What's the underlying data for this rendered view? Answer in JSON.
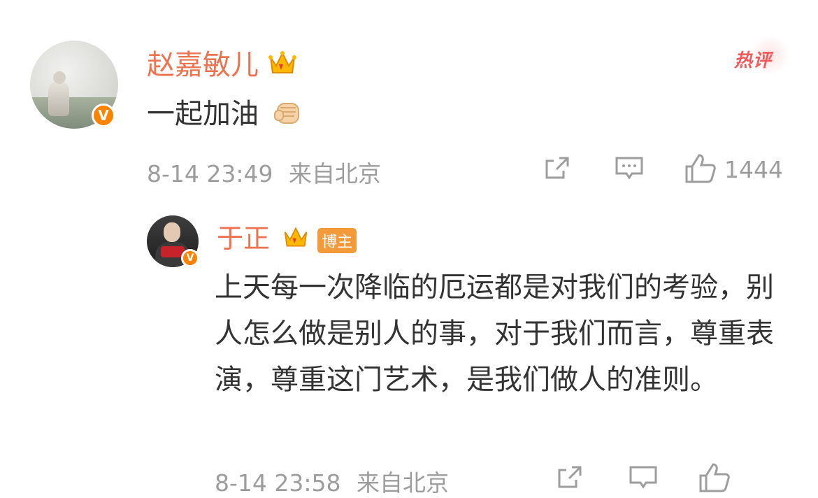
{
  "comment": {
    "username": "赵嘉敏儿",
    "verified_badge": "V",
    "crown_icon": "crown-icon",
    "text": "一起加油",
    "emoji_icon": "fist-emoji-icon",
    "tag": "热评",
    "meta_time": "8-14 23:49",
    "meta_location": "来自北京",
    "like_count": "1444"
  },
  "reply": {
    "username": "于正",
    "verified_badge": "V",
    "blogger_tag": "博主",
    "text": "上天每一次降临的厄运都是对我们的考验，别人怎么做是别人的事，对于我们而言，尊重表演，尊重这门艺术，是我们做人的准则。",
    "meta_time": "8-14 23:58",
    "meta_location": "来自北京"
  },
  "colors": {
    "name": "#eb7350",
    "text": "#333333",
    "meta": "#9d9d9d",
    "verified": "#ff8200"
  }
}
